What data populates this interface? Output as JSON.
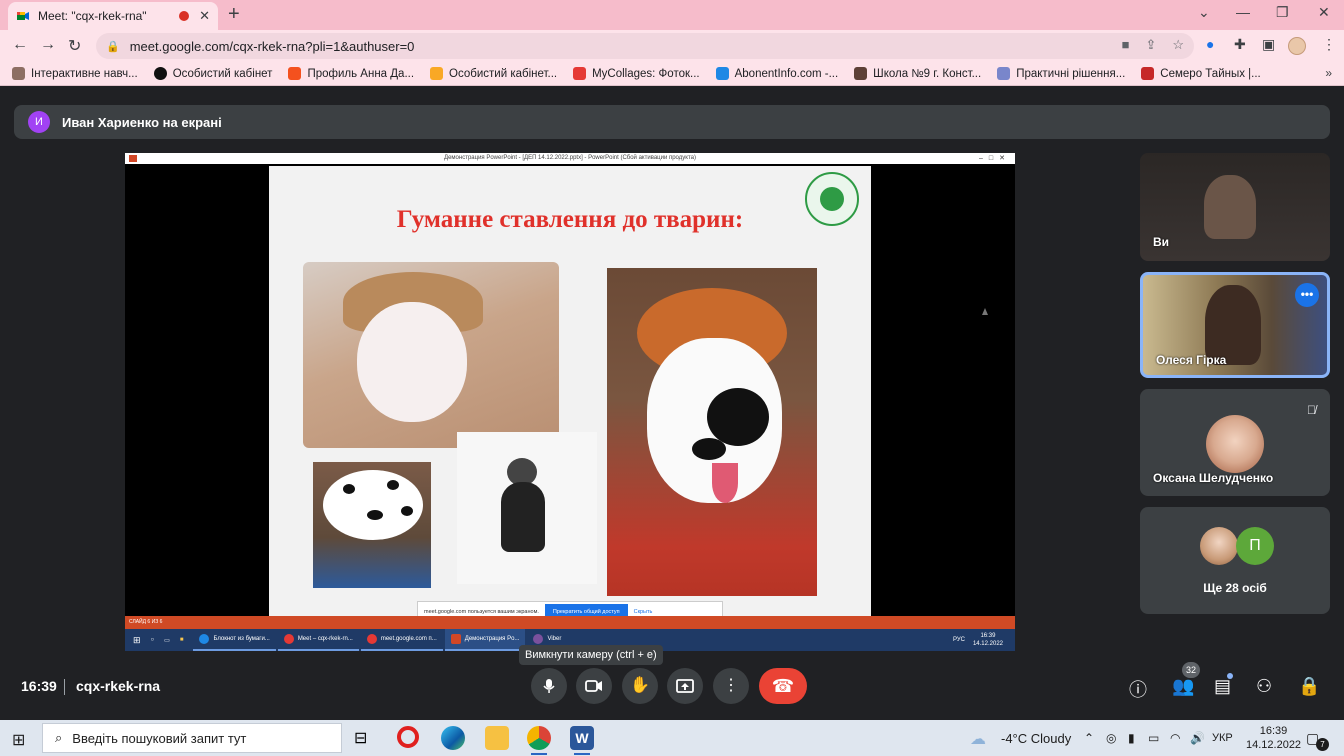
{
  "browser": {
    "tab_title": "Meet: \"cqx-rkek-rna\"",
    "tab_close": "✕",
    "new_tab": "+",
    "window_controls": [
      "⌄",
      "—",
      "❐",
      "✕"
    ],
    "url": "meet.google.com/cqx-rkek-rna?pli=1&authuser=0",
    "bookmarks": [
      {
        "label": "Інтерактивне навч...",
        "color": "#8d6e63"
      },
      {
        "label": "Особистий кабінет",
        "color": "#111111"
      },
      {
        "label": "Профиль Анна Да...",
        "color": "#f4511e"
      },
      {
        "label": "Особистий кабінет...",
        "color": "#f9a825"
      },
      {
        "label": "MyCollages: Фоток...",
        "color": "#e53935"
      },
      {
        "label": "AbonentInfo.com -...",
        "color": "#1e88e5"
      },
      {
        "label": "Школа №9 г. Конст...",
        "color": "#5d4037"
      },
      {
        "label": "Практичні рішення...",
        "color": "#7986cb"
      },
      {
        "label": "Семеро Тайных |...",
        "color": "#c62828"
      }
    ]
  },
  "meet": {
    "presenter_initial": "И",
    "presenter_text": "Иван Хариенко на екрані",
    "shared_screen": {
      "window_title": "Демонстрация PowerPoint - [ДЕП 14.12.2022.pptx] - PowerPoint (Сбой активации продукта)",
      "slide_title": "Гуманне ставлення до тварин:",
      "share_notice": "meet.google.com пользуется вашим экраном.",
      "stop_sharing": "Прекратить общий доступ",
      "hide": "Скрыть",
      "status_bar": "СЛАЙД 6 ИЗ 6",
      "taskbar_items": [
        {
          "label": "Блокнот из бумаги...",
          "color": "#1e88e5"
        },
        {
          "label": "Meet – cqx-rkek-rn...",
          "color": "#e53935"
        },
        {
          "label": "meet.google.com п...",
          "color": "#e53935"
        },
        {
          "label": "Демонстрация Po...",
          "color": "#d24726"
        },
        {
          "label": "Viber",
          "color": "#7b519d"
        }
      ],
      "tray_lang": "РУС",
      "tray_time": "16:39",
      "tray_date": "14.12.2022"
    },
    "tooltip": "Вимкнути камеру (ctrl + e)",
    "participants": [
      {
        "name": "Ви"
      },
      {
        "name": "Олеся Гірка"
      },
      {
        "name": "Оксана Шелудченко"
      },
      {
        "name": "Ще 28 осіб",
        "initial": "П"
      }
    ],
    "meeting_time": "16:39",
    "meeting_code": "cqx-rkek-rna",
    "people_count": "32"
  },
  "taskbar": {
    "search_placeholder": "Введіть пошуковий запит тут",
    "weather": "-4°C  Cloudy",
    "lang": "УКР",
    "time": "16:39",
    "date": "14.12.2022",
    "notifications": "7"
  }
}
